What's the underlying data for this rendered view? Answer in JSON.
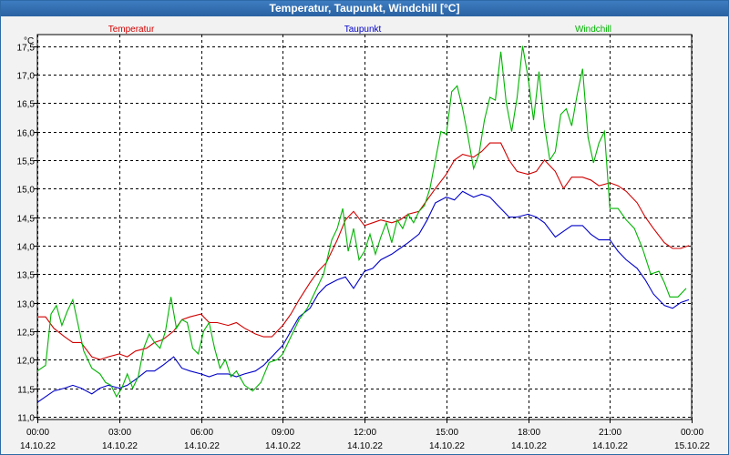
{
  "window": {
    "title": "Temperatur, Taupunkt, Windchill [°C]"
  },
  "chart_data": {
    "type": "line",
    "title": "Temperatur, Taupunkt, Windchill [°C]",
    "ylabel": "°C",
    "ylim": [
      10.95,
      17.7
    ],
    "y_ticks": [
      "11,0",
      "11,5",
      "12,0",
      "12,5",
      "13,0",
      "13,5",
      "14,0",
      "14,5",
      "15,0",
      "15,5",
      "16,0",
      "16,5",
      "17,0",
      "17,5"
    ],
    "xlim": [
      0,
      24
    ],
    "x_ticks": [
      {
        "time": "00:00",
        "date": "14.10.22"
      },
      {
        "time": "03:00",
        "date": "14.10.22"
      },
      {
        "time": "06:00",
        "date": "14.10.22"
      },
      {
        "time": "09:00",
        "date": "14.10.22"
      },
      {
        "time": "12:00",
        "date": "14.10.22"
      },
      {
        "time": "15:00",
        "date": "14.10.22"
      },
      {
        "time": "18:00",
        "date": "14.10.22"
      },
      {
        "time": "21:00",
        "date": "14.10.22"
      },
      {
        "time": "00:00",
        "date": "15.10.22"
      }
    ],
    "grid": true,
    "legend_position": "top",
    "series": [
      {
        "name": "Temperatur",
        "color": "#d00000",
        "points": [
          [
            0,
            12.75
          ],
          [
            0.3,
            12.75
          ],
          [
            0.6,
            12.55
          ],
          [
            1,
            12.4
          ],
          [
            1.3,
            12.3
          ],
          [
            1.6,
            12.3
          ],
          [
            2,
            12.05
          ],
          [
            2.3,
            12.0
          ],
          [
            2.6,
            12.05
          ],
          [
            3,
            12.1
          ],
          [
            3.3,
            12.05
          ],
          [
            3.6,
            12.15
          ],
          [
            4,
            12.2
          ],
          [
            4.3,
            12.3
          ],
          [
            4.6,
            12.35
          ],
          [
            5,
            12.5
          ],
          [
            5.3,
            12.7
          ],
          [
            5.6,
            12.75
          ],
          [
            6,
            12.8
          ],
          [
            6.3,
            12.65
          ],
          [
            6.6,
            12.65
          ],
          [
            7,
            12.6
          ],
          [
            7.3,
            12.65
          ],
          [
            7.6,
            12.55
          ],
          [
            8,
            12.45
          ],
          [
            8.3,
            12.4
          ],
          [
            8.6,
            12.4
          ],
          [
            9,
            12.6
          ],
          [
            9.3,
            12.8
          ],
          [
            9.6,
            13.05
          ],
          [
            10,
            13.35
          ],
          [
            10.3,
            13.55
          ],
          [
            10.6,
            13.7
          ],
          [
            11,
            14.1
          ],
          [
            11.3,
            14.45
          ],
          [
            11.6,
            14.6
          ],
          [
            12,
            14.35
          ],
          [
            12.3,
            14.4
          ],
          [
            12.6,
            14.45
          ],
          [
            13,
            14.4
          ],
          [
            13.3,
            14.45
          ],
          [
            13.6,
            14.55
          ],
          [
            14,
            14.6
          ],
          [
            14.3,
            14.8
          ],
          [
            14.6,
            15.0
          ],
          [
            15,
            15.25
          ],
          [
            15.3,
            15.5
          ],
          [
            15.6,
            15.6
          ],
          [
            16,
            15.55
          ],
          [
            16.3,
            15.65
          ],
          [
            16.6,
            15.8
          ],
          [
            17,
            15.8
          ],
          [
            17.3,
            15.5
          ],
          [
            17.6,
            15.3
          ],
          [
            18,
            15.25
          ],
          [
            18.3,
            15.3
          ],
          [
            18.6,
            15.5
          ],
          [
            19,
            15.3
          ],
          [
            19.3,
            15.0
          ],
          [
            19.6,
            15.2
          ],
          [
            20,
            15.2
          ],
          [
            20.3,
            15.15
          ],
          [
            20.6,
            15.05
          ],
          [
            21,
            15.1
          ],
          [
            21.3,
            15.05
          ],
          [
            21.6,
            14.95
          ],
          [
            22,
            14.75
          ],
          [
            22.3,
            14.5
          ],
          [
            22.6,
            14.3
          ],
          [
            23,
            14.05
          ],
          [
            23.3,
            13.95
          ],
          [
            23.6,
            13.95
          ],
          [
            23.9,
            14.0
          ]
        ]
      },
      {
        "name": "Taupunkt",
        "color": "#0000c8",
        "points": [
          [
            0,
            11.25
          ],
          [
            0.3,
            11.35
          ],
          [
            0.6,
            11.45
          ],
          [
            1,
            11.5
          ],
          [
            1.3,
            11.55
          ],
          [
            1.6,
            11.5
          ],
          [
            2,
            11.4
          ],
          [
            2.3,
            11.5
          ],
          [
            2.6,
            11.55
          ],
          [
            3,
            11.5
          ],
          [
            3.3,
            11.55
          ],
          [
            3.6,
            11.65
          ],
          [
            4,
            11.8
          ],
          [
            4.3,
            11.8
          ],
          [
            4.6,
            11.9
          ],
          [
            5,
            12.05
          ],
          [
            5.3,
            11.85
          ],
          [
            5.6,
            11.8
          ],
          [
            6,
            11.75
          ],
          [
            6.3,
            11.7
          ],
          [
            6.6,
            11.75
          ],
          [
            7,
            11.75
          ],
          [
            7.3,
            11.7
          ],
          [
            7.6,
            11.75
          ],
          [
            8,
            11.8
          ],
          [
            8.3,
            11.9
          ],
          [
            8.6,
            12.05
          ],
          [
            9,
            12.25
          ],
          [
            9.3,
            12.5
          ],
          [
            9.6,
            12.75
          ],
          [
            10,
            12.9
          ],
          [
            10.3,
            13.15
          ],
          [
            10.6,
            13.3
          ],
          [
            11,
            13.4
          ],
          [
            11.3,
            13.45
          ],
          [
            11.6,
            13.25
          ],
          [
            12,
            13.55
          ],
          [
            12.3,
            13.6
          ],
          [
            12.6,
            13.75
          ],
          [
            13,
            13.85
          ],
          [
            13.3,
            13.95
          ],
          [
            13.6,
            14.05
          ],
          [
            14,
            14.2
          ],
          [
            14.3,
            14.45
          ],
          [
            14.6,
            14.75
          ],
          [
            15,
            14.85
          ],
          [
            15.3,
            14.8
          ],
          [
            15.6,
            14.95
          ],
          [
            16,
            14.85
          ],
          [
            16.3,
            14.9
          ],
          [
            16.6,
            14.85
          ],
          [
            17,
            14.65
          ],
          [
            17.3,
            14.5
          ],
          [
            17.6,
            14.5
          ],
          [
            18,
            14.55
          ],
          [
            18.3,
            14.5
          ],
          [
            18.6,
            14.4
          ],
          [
            19,
            14.15
          ],
          [
            19.3,
            14.25
          ],
          [
            19.6,
            14.35
          ],
          [
            20,
            14.35
          ],
          [
            20.3,
            14.2
          ],
          [
            20.6,
            14.1
          ],
          [
            21,
            14.1
          ],
          [
            21.3,
            13.9
          ],
          [
            21.6,
            13.75
          ],
          [
            22,
            13.6
          ],
          [
            22.3,
            13.4
          ],
          [
            22.6,
            13.15
          ],
          [
            23,
            12.95
          ],
          [
            23.3,
            12.9
          ],
          [
            23.6,
            13.0
          ],
          [
            23.9,
            13.05
          ]
        ]
      },
      {
        "name": "Windchill",
        "color": "#00b400",
        "points": [
          [
            0,
            11.8
          ],
          [
            0.3,
            11.9
          ],
          [
            0.5,
            12.8
          ],
          [
            0.7,
            12.95
          ],
          [
            0.9,
            12.6
          ],
          [
            1.1,
            12.85
          ],
          [
            1.3,
            13.05
          ],
          [
            1.5,
            12.6
          ],
          [
            1.7,
            12.15
          ],
          [
            2,
            11.85
          ],
          [
            2.3,
            11.75
          ],
          [
            2.5,
            11.6
          ],
          [
            2.7,
            11.55
          ],
          [
            2.9,
            11.35
          ],
          [
            3.1,
            11.5
          ],
          [
            3.3,
            11.75
          ],
          [
            3.5,
            11.5
          ],
          [
            3.7,
            11.7
          ],
          [
            3.9,
            12.2
          ],
          [
            4.1,
            12.45
          ],
          [
            4.3,
            12.3
          ],
          [
            4.5,
            12.2
          ],
          [
            4.7,
            12.5
          ],
          [
            4.9,
            13.1
          ],
          [
            5.1,
            12.55
          ],
          [
            5.3,
            12.7
          ],
          [
            5.5,
            12.65
          ],
          [
            5.7,
            12.2
          ],
          [
            5.9,
            12.1
          ],
          [
            6.1,
            12.5
          ],
          [
            6.3,
            12.65
          ],
          [
            6.5,
            12.2
          ],
          [
            6.7,
            11.85
          ],
          [
            6.9,
            12.0
          ],
          [
            7.1,
            11.7
          ],
          [
            7.3,
            11.8
          ],
          [
            7.6,
            11.55
          ],
          [
            7.9,
            11.45
          ],
          [
            8.2,
            11.6
          ],
          [
            8.5,
            11.95
          ],
          [
            8.8,
            12.0
          ],
          [
            9,
            12.1
          ],
          [
            9.3,
            12.4
          ],
          [
            9.6,
            12.7
          ],
          [
            9.9,
            12.9
          ],
          [
            10.2,
            13.2
          ],
          [
            10.5,
            13.5
          ],
          [
            10.8,
            14.1
          ],
          [
            11,
            14.3
          ],
          [
            11.2,
            14.65
          ],
          [
            11.4,
            13.9
          ],
          [
            11.6,
            14.3
          ],
          [
            11.8,
            13.75
          ],
          [
            12,
            13.9
          ],
          [
            12.2,
            14.2
          ],
          [
            12.4,
            13.85
          ],
          [
            12.6,
            14.15
          ],
          [
            12.8,
            14.4
          ],
          [
            13,
            14.05
          ],
          [
            13.2,
            14.45
          ],
          [
            13.4,
            14.3
          ],
          [
            13.6,
            14.55
          ],
          [
            13.8,
            14.4
          ],
          [
            14,
            14.6
          ],
          [
            14.2,
            14.7
          ],
          [
            14.4,
            15.0
          ],
          [
            14.6,
            15.5
          ],
          [
            14.8,
            16.0
          ],
          [
            15,
            15.95
          ],
          [
            15.2,
            16.7
          ],
          [
            15.4,
            16.8
          ],
          [
            15.6,
            16.4
          ],
          [
            15.8,
            15.9
          ],
          [
            16,
            15.35
          ],
          [
            16.2,
            15.6
          ],
          [
            16.4,
            16.2
          ],
          [
            16.6,
            16.6
          ],
          [
            16.8,
            16.55
          ],
          [
            17,
            17.4
          ],
          [
            17.2,
            16.5
          ],
          [
            17.4,
            16.0
          ],
          [
            17.6,
            16.6
          ],
          [
            17.8,
            17.5
          ],
          [
            18,
            16.95
          ],
          [
            18.2,
            16.2
          ],
          [
            18.4,
            17.05
          ],
          [
            18.6,
            16.1
          ],
          [
            18.8,
            15.5
          ],
          [
            19,
            15.65
          ],
          [
            19.2,
            16.3
          ],
          [
            19.4,
            16.4
          ],
          [
            19.6,
            16.1
          ],
          [
            19.8,
            16.65
          ],
          [
            20,
            17.1
          ],
          [
            20.2,
            15.9
          ],
          [
            20.4,
            15.45
          ],
          [
            20.6,
            15.8
          ],
          [
            20.8,
            16.0
          ],
          [
            21,
            14.65
          ],
          [
            21.3,
            14.65
          ],
          [
            21.6,
            14.45
          ],
          [
            21.9,
            14.3
          ],
          [
            22.2,
            13.95
          ],
          [
            22.5,
            13.5
          ],
          [
            22.8,
            13.55
          ],
          [
            23,
            13.35
          ],
          [
            23.2,
            13.1
          ],
          [
            23.5,
            13.1
          ],
          [
            23.8,
            13.25
          ]
        ]
      }
    ]
  }
}
